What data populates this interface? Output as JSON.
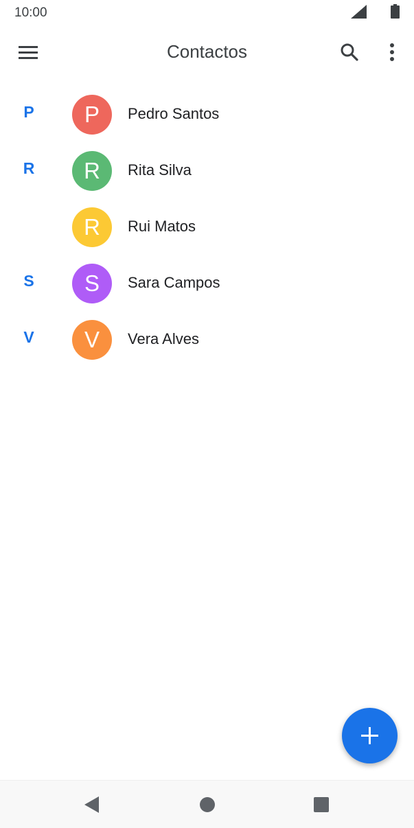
{
  "status_bar": {
    "time": "10:00",
    "signal_icon": "cell-signal-icon",
    "battery_icon": "battery-icon"
  },
  "app_bar": {
    "title": "Contactos",
    "menu_icon": "hamburger-menu-icon",
    "search_icon": "search-icon",
    "more_icon": "more-vert-icon"
  },
  "contacts": [
    {
      "section": "P",
      "initial": "P",
      "name": "Pedro Santos",
      "color": "#ee675c"
    },
    {
      "section": "R",
      "initial": "R",
      "name": "Rita Silva",
      "color": "#5bb974"
    },
    {
      "section": "",
      "initial": "R",
      "name": "Rui Matos",
      "color": "#fcc934"
    },
    {
      "section": "S",
      "initial": "S",
      "name": "Sara Campos",
      "color": "#af5cf7"
    },
    {
      "section": "V",
      "initial": "V",
      "name": "Vera Alves",
      "color": "#fa903e"
    }
  ],
  "fab": {
    "icon": "plus-icon",
    "color": "#1a73e8"
  },
  "nav_bar": {
    "back_icon": "nav-back-icon",
    "home_icon": "nav-home-icon",
    "recents_icon": "nav-recents-icon"
  },
  "colors": {
    "accent": "#1a73e8",
    "text": "#202124",
    "nav_background": "#f8f8f8"
  }
}
